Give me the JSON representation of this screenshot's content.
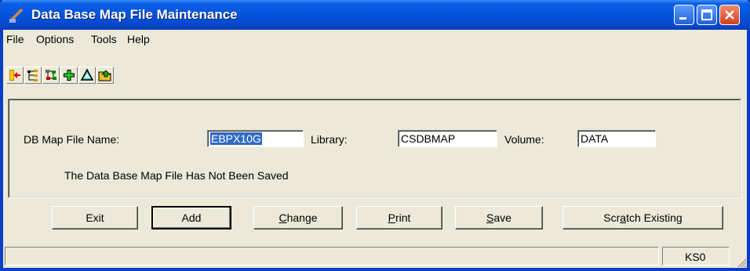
{
  "window": {
    "title": "Data Base Map File Maintenance"
  },
  "menu": {
    "items": [
      "File",
      "Options",
      "Tools",
      "Help"
    ]
  },
  "toolbar": {
    "tools": [
      {
        "icon": "exit-door-icon"
      },
      {
        "icon": "tree-structure-icon"
      },
      {
        "icon": "tree-network-icon"
      },
      {
        "icon": "add-plus-icon"
      },
      {
        "icon": "triangle-icon"
      },
      {
        "icon": "folder-icon"
      }
    ]
  },
  "form": {
    "map_file_label": "DB Map File Name:",
    "map_file_value": "EBPX10G",
    "library_label": "Library:",
    "library_value": "CSDBMAP",
    "volume_label": "Volume:",
    "volume_value": "DATA",
    "status_message": "The Data Base Map File Has Not Been Saved"
  },
  "buttons": {
    "exit": "Exit",
    "add": "Add",
    "change_hot": "C",
    "change_rest": "hange",
    "print_hot": "P",
    "print_rest": "rint",
    "save_hot": "S",
    "save_rest": "ave",
    "scratch_pre": "Scr",
    "scratch_hot": "a",
    "scratch_rest": "tch Existing"
  },
  "statusbar": {
    "code": "KS0"
  },
  "colors": {
    "titlebar": "#0553dc",
    "face": "#ece9d8",
    "selection": "#316ac5",
    "close": "#d2401c"
  }
}
